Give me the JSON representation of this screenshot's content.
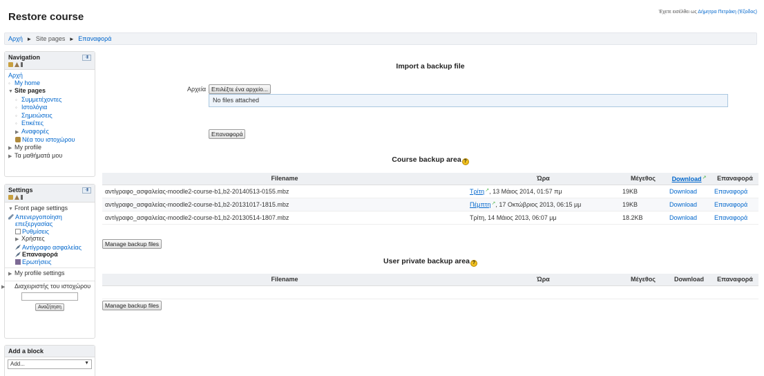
{
  "header": {
    "title": "Restore course",
    "login_prefix": "Έχετε εισέλθει ως",
    "login_user": "Δήμητρα Πετράκη",
    "logout": "(Έξοδος)"
  },
  "breadcrumb": {
    "items": [
      "Αρχή",
      "Site pages",
      "Επαναφορά"
    ]
  },
  "navigation_block": {
    "title": "Navigation",
    "items": {
      "home": "Αρχή",
      "myhome": "My home",
      "sitepages": "Site pages",
      "participants": "Συμμετέχοντες",
      "blogs": "Ιστολόγια",
      "notes": "Σημειώσεις",
      "tags": "Ετικέτες",
      "reports": "Αναφορές",
      "sitenews": "Νέα του ιστοχώρου",
      "myprofile": "My profile",
      "mycourses": "Τα μαθήματά μου"
    }
  },
  "settings_block": {
    "title": "Settings",
    "items": {
      "frontpage": "Front page settings",
      "editing": "Απενεργοποίηση επεξεργασίας",
      "settings": "Ρυθμίσεις",
      "users": "Χρήστες",
      "backup": "Αντίγραφο ασφαλείας",
      "restore": "Επαναφορά",
      "questions": "Ερωτήσεις",
      "myprofilesettings": "My profile settings",
      "siteadmin": "Διαχειριστής του ιστοχώρου"
    },
    "search_button": "Αναζήτηση"
  },
  "add_block": {
    "title": "Add a block",
    "select_value": "Add..."
  },
  "import": {
    "heading": "Import a backup file",
    "files_label": "Αρχεία",
    "choose_button": "Επιλέξτε ένα αρχείο...",
    "no_files": "No files attached",
    "restore_button": "Επαναφορά"
  },
  "course_backup": {
    "heading": "Course backup area",
    "columns": [
      "Filename",
      "Ώρα",
      "Μέγεθος",
      "Download",
      "Επαναφορά"
    ],
    "rows": [
      {
        "filename": "αντίγραφο_ασφαλείας-moodle2-course-b1,b2-20140513-0155.mbz",
        "day": "Τρίτη",
        "time": ", 13 Μάιος 2014, 01:57 πμ",
        "size": "19KB",
        "download": "Download",
        "restore": "Επαναφορά"
      },
      {
        "filename": "αντίγραφο_ασφαλείας-moodle2-course-b1,b2-20131017-1815.mbz",
        "day": "Πέμπτη",
        "time": ", 17 Οκτώβριος 2013, 06:15 μμ",
        "size": "19KB",
        "download": "Download",
        "restore": "Επαναφορά"
      },
      {
        "filename": "αντίγραφο_ασφαλείας-moodle2-course-b1,b2-20130514-1807.mbz",
        "day": "",
        "time": "Τρίτη, 14 Μάιος 2013, 06:07 μμ",
        "size": "18.2KB",
        "download": "Download",
        "restore": "Επαναφορά"
      }
    ],
    "manage_button": "Manage backup files"
  },
  "private_backup": {
    "heading": "User private backup area",
    "columns": [
      "Filename",
      "Ώρα",
      "Μέγεθος",
      "Download",
      "Επαναφορά"
    ],
    "manage_button": "Manage backup files"
  }
}
